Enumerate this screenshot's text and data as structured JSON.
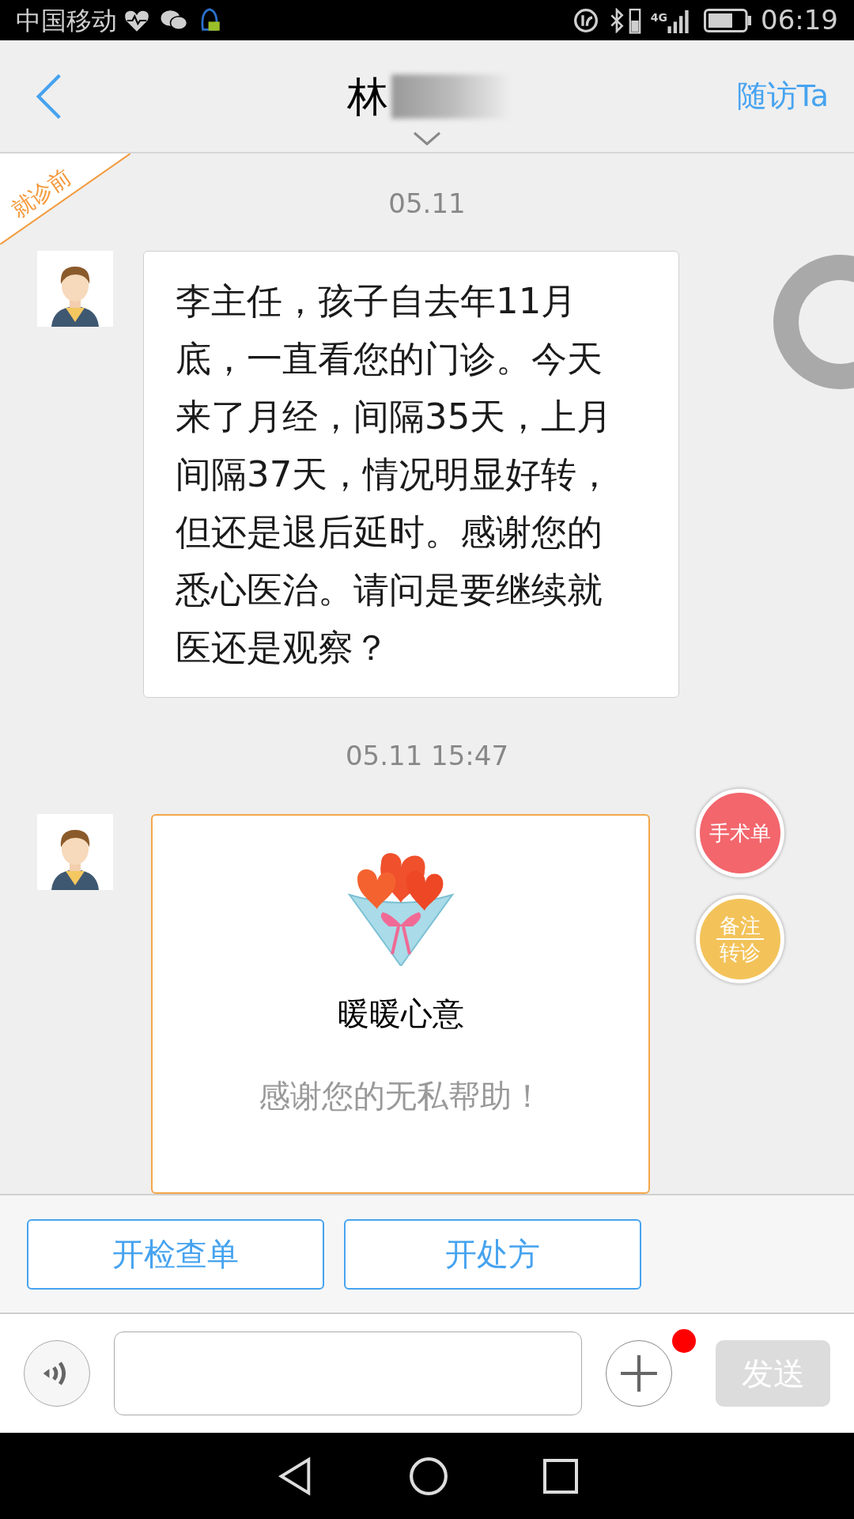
{
  "status_bar": {
    "carrier": "中国移动",
    "time": "06:19",
    "network": "4G"
  },
  "header": {
    "title": "林",
    "action": "随访Ta"
  },
  "ribbon": {
    "label": "就诊前"
  },
  "messages": [
    {
      "kind": "text",
      "timestamp": "05.11",
      "text": "李主任，孩子自去年11月底，一直看您的门诊。今天来了月经，间隔35天，上月间隔37天，情况明显好转，但还是退后延时。感谢您的悉心医治。请问是要继续就医还是观察？"
    },
    {
      "kind": "gift",
      "timestamp": "05.11 15:47",
      "title": "暖暖心意",
      "text": "感谢您的无私帮助！"
    }
  ],
  "side_buttons": [
    {
      "kind": "single",
      "color": "#f2666c",
      "lines": [
        "手术单"
      ]
    },
    {
      "kind": "split",
      "color": "#f3c35a",
      "lines": [
        "备注",
        "转诊"
      ]
    }
  ],
  "action_buttons": [
    "开检查单",
    "开处方"
  ],
  "input_bar": {
    "send": "发送",
    "send_disabled": true,
    "plus_badge": true
  }
}
